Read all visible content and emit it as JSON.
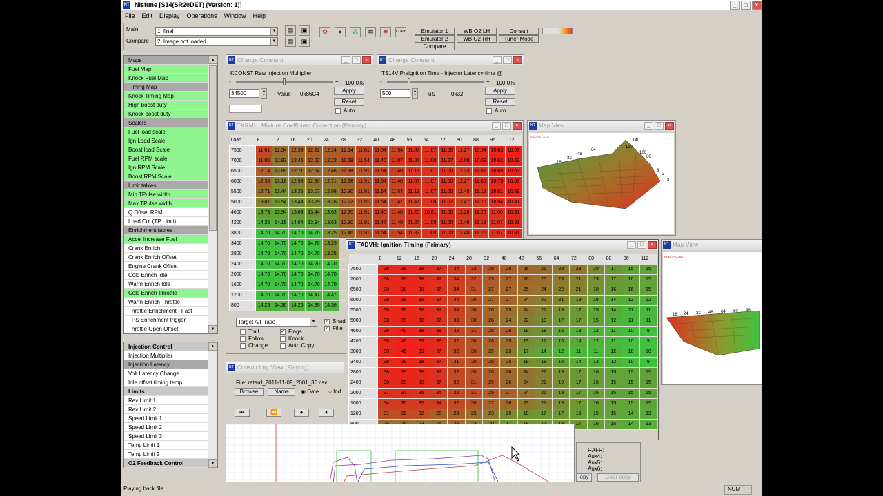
{
  "app": {
    "title": "Nistune [S14(SR20DET) (Version: 1)]",
    "status": "Playing back file",
    "status_num": "NUM"
  },
  "menu": [
    "File",
    "Edit",
    "Display",
    "Operations",
    "Window",
    "Help"
  ],
  "toolbar": {
    "main_label": "Main:",
    "main_value": "1: final",
    "compare_label": "Compare",
    "compare_value": "2: Image not loaded",
    "modes": [
      "Emulator 1",
      "WB O2 LH",
      "Consult",
      "Emulator 2",
      "WB O2 RH",
      "Tuner Mode",
      "Compare"
    ]
  },
  "nav": [
    {
      "t": "Maps",
      "s": "hdr"
    },
    {
      "t": "Fuel Map",
      "s": "green"
    },
    {
      "t": "Knock Fuel Map",
      "s": "green"
    },
    {
      "t": "Timing Map",
      "s": "hdr"
    },
    {
      "t": "Knock Timing Map",
      "s": "green"
    },
    {
      "t": "High boost duty",
      "s": "green"
    },
    {
      "t": "Knock boost duty",
      "s": "green"
    },
    {
      "t": "Scalers",
      "s": "hdr"
    },
    {
      "t": "Fuel load scale",
      "s": "green"
    },
    {
      "t": "Ign Load Scale",
      "s": "green"
    },
    {
      "t": "Boost load Scale",
      "s": "green"
    },
    {
      "t": "Fuel RPM scale",
      "s": "green"
    },
    {
      "t": "Ign RPM Scale",
      "s": "green"
    },
    {
      "t": "Boost RPM Scale",
      "s": "green"
    },
    {
      "t": "Limit tables",
      "s": "hdr"
    },
    {
      "t": "Min TPulse width",
      "s": "green"
    },
    {
      "t": "Max TPulse width",
      "s": "green"
    },
    {
      "t": "Q Offset RPM",
      "s": ""
    },
    {
      "t": "Load Cut (TP Limit)",
      "s": ""
    },
    {
      "t": "Enrichment tables",
      "s": "hdr"
    },
    {
      "t": "Accel Increase Fuel",
      "s": "green"
    },
    {
      "t": "Crank Enrich",
      "s": ""
    },
    {
      "t": "Crank Enrich Offset",
      "s": ""
    },
    {
      "t": "Engine Crank Offset",
      "s": ""
    },
    {
      "t": "Cold Enrich Idle",
      "s": ""
    },
    {
      "t": "Warm Enrich Idle",
      "s": ""
    },
    {
      "t": "Cold Enrich Throttle",
      "s": "green"
    },
    {
      "t": "Warm Enrich Throttle",
      "s": ""
    },
    {
      "t": "Throttle Enrichment - Fast",
      "s": ""
    },
    {
      "t": "TPS Enrichment trigger",
      "s": ""
    },
    {
      "t": "Throttle Open Offset",
      "s": ""
    }
  ],
  "nav2": [
    {
      "t": "Injection Control",
      "s": "hdr bold"
    },
    {
      "t": "Injection Multiplier",
      "s": ""
    },
    {
      "t": "Injection Latency",
      "s": "hdr"
    },
    {
      "t": "Volt Latency Change",
      "s": ""
    },
    {
      "t": "Idle offset timing temp",
      "s": ""
    },
    {
      "t": "Limits",
      "s": "hdr bold"
    },
    {
      "t": "Rev Limit 1",
      "s": ""
    },
    {
      "t": "Rev Limit 2",
      "s": ""
    },
    {
      "t": "Speed Limit 1",
      "s": ""
    },
    {
      "t": "Speed Limit 2",
      "s": ""
    },
    {
      "t": "Speed Limit 3",
      "s": ""
    },
    {
      "t": "Temp Limit 1",
      "s": ""
    },
    {
      "t": "Temp Limit 2",
      "s": ""
    },
    {
      "t": "O2 Feedback Control",
      "s": "hdr bold"
    }
  ],
  "cc1": {
    "title": "Change Constant",
    "label": "KCONST Raw Injection Mulitplier",
    "minus": "-",
    "plus": "+",
    "pct": "100.0%",
    "value": "34500",
    "value_label": "Value",
    "hex": "0x86C4",
    "apply": "Apply",
    "reset": "Reset",
    "auto": "Auto"
  },
  "cc2": {
    "title": "Change Constant",
    "label": "TS14V Preignition Time - Injector Latency time @",
    "minus": "-",
    "plus": "+",
    "pct": "100.0%",
    "value": "500",
    "unit": "uS",
    "hex": "0x32",
    "apply": "Apply",
    "reset": "Reset",
    "auto": "Auto"
  },
  "fuel": {
    "title": "TKRMH: Mixture Coefficient Correction (Primary)",
    "corner": "Load",
    "cols": [
      "8",
      "12",
      "16",
      "20",
      "24",
      "28",
      "32",
      "40",
      "48",
      "56",
      "64",
      "72",
      "80",
      "88",
      "96",
      "112"
    ],
    "rows": [
      "7500",
      "7000",
      "6500",
      "6000",
      "5500",
      "5000",
      "4600",
      "4200",
      "3800",
      "3400",
      "2800",
      "2400",
      "2000",
      "1600",
      "1200",
      "800"
    ],
    "data": [
      [
        "11.61",
        "12.54",
        "12.38",
        "12.22",
        "12.14",
        "12.14",
        "11.61",
        "11.54",
        "11.54",
        "11.07",
        "11.07",
        "11.00",
        "11.27",
        "10.94",
        "10.63",
        "10.63"
      ],
      [
        "11.80",
        "12.83",
        "12.46",
        "12.22",
        "12.22",
        "11.69",
        "11.54",
        "11.40",
        "11.07",
        "11.07",
        "11.00",
        "11.27",
        "11.00",
        "10.69",
        "10.63",
        "10.63"
      ],
      [
        "12.14",
        "12.89",
        "12.71",
        "12.54",
        "12.46",
        "11.98",
        "11.91",
        "11.54",
        "11.40",
        "11.13",
        "11.07",
        "11.00",
        "11.33",
        "11.07",
        "10.69",
        "10.63"
      ],
      [
        "12.38",
        "13.18",
        "12.98",
        "12.80",
        "12.71",
        "12.38",
        "11.91",
        "11.54",
        "11.40",
        "11.07",
        "11.07",
        "11.00",
        "11.27",
        "11.00",
        "10.75",
        "10.63"
      ],
      [
        "12.71",
        "13.44",
        "13.25",
        "13.07",
        "12.98",
        "12.30",
        "11.91",
        "11.54",
        "11.54",
        "11.13",
        "11.07",
        "11.00",
        "11.40",
        "11.13",
        "10.81",
        "10.69"
      ],
      [
        "13.07",
        "13.54",
        "13.44",
        "13.29",
        "13.16",
        "12.22",
        "11.91",
        "11.54",
        "11.47",
        "11.47",
        "11.00",
        "11.07",
        "11.47",
        "11.20",
        "10.94",
        "10.81"
      ],
      [
        "13.73",
        "13.94",
        "13.63",
        "13.44",
        "13.63",
        "12.30",
        "11.91",
        "11.40",
        "11.40",
        "11.20",
        "10.81",
        "11.00",
        "11.20",
        "11.20",
        "11.00",
        "10.81"
      ],
      [
        "14.25",
        "14.15",
        "14.04",
        "13.94",
        "13.63",
        "12.30",
        "11.91",
        "11.47",
        "11.40",
        "11.27",
        "11.00",
        "11.00",
        "11.40",
        "11.13",
        "11.07",
        "10.81"
      ],
      [
        "14.70",
        "14.70",
        "14.70",
        "14.70",
        "13.25",
        "12.46",
        "11.91",
        "11.54",
        "11.54",
        "11.33",
        "11.00",
        "11.00",
        "11.40",
        "11.20",
        "11.07",
        "10.81"
      ],
      [
        "14.70",
        "14.70",
        "14.70",
        "14.70",
        "13.25",
        "",
        "",
        "",
        "",
        "",
        "",
        "",
        "",
        "",
        "",
        ""
      ],
      [
        "14.70",
        "14.70",
        "14.70",
        "14.70",
        "13.25",
        "",
        "",
        "",
        "",
        "",
        "",
        "",
        "",
        "",
        "",
        ""
      ],
      [
        "14.70",
        "14.70",
        "14.70",
        "14.70",
        "14.70",
        "",
        "",
        "",
        "",
        "",
        "",
        "",
        "",
        "",
        "",
        ""
      ],
      [
        "14.70",
        "14.70",
        "14.70",
        "14.70",
        "14.70",
        "",
        "",
        "",
        "",
        "",
        "",
        "",
        "",
        "",
        "",
        ""
      ],
      [
        "14.70",
        "14.70",
        "14.70",
        "14.70",
        "14.70",
        "",
        "",
        "",
        "",
        "",
        "",
        "",
        "",
        "",
        "",
        ""
      ],
      [
        "14.70",
        "14.70",
        "14.70",
        "14.47",
        "14.47",
        "",
        "",
        "",
        "",
        "",
        "",
        "",
        "",
        "",
        "",
        ""
      ],
      [
        "14.25",
        "14.36",
        "14.26",
        "14.36",
        "14.36",
        "",
        "",
        "",
        "",
        "",
        "",
        "",
        "",
        "",
        "",
        ""
      ]
    ]
  },
  "fuel_opts": {
    "target": "Target A/F ratio",
    "trail": "Trail",
    "follow": "Follow",
    "change": "Change",
    "flags": "Flags",
    "knock": "Knock",
    "autocopy": "Auto Copy",
    "shade": "Shad",
    "filled": "Fille"
  },
  "timing": {
    "title": "TADVH: Ignition Timing (Primary)",
    "corner": "",
    "cols": [
      "8",
      "12",
      "16",
      "20",
      "24",
      "28",
      "32",
      "40",
      "48",
      "56",
      "64",
      "72",
      "80",
      "88",
      "96",
      "112"
    ],
    "rows": [
      "7500",
      "7000",
      "6500",
      "6000",
      "5500",
      "5000",
      "4600",
      "4200",
      "3800",
      "3400",
      "2800",
      "2400",
      "2000",
      "1600",
      "1200",
      "800"
    ],
    "data": [
      [
        "38",
        "39",
        "38",
        "37",
        "34",
        "32",
        "29",
        "28",
        "26",
        "25",
        "23",
        "23",
        "20",
        "17",
        "15",
        "15"
      ],
      [
        "38",
        "39",
        "38",
        "37",
        "34",
        "32",
        "29",
        "27",
        "26",
        "25",
        "23",
        "21",
        "19",
        "17",
        "16",
        "15"
      ],
      [
        "38",
        "39",
        "38",
        "37",
        "34",
        "31",
        "27",
        "27",
        "25",
        "24",
        "22",
        "21",
        "18",
        "16",
        "16",
        "15"
      ],
      [
        "38",
        "39",
        "38",
        "37",
        "34",
        "30",
        "27",
        "27",
        "24",
        "22",
        "21",
        "19",
        "16",
        "14",
        "13",
        "12"
      ],
      [
        "38",
        "39",
        "38",
        "37",
        "34",
        "30",
        "26",
        "25",
        "24",
        "21",
        "19",
        "17",
        "15",
        "14",
        "11",
        "11"
      ],
      [
        "38",
        "39",
        "38",
        "37",
        "33",
        "30",
        "26",
        "24",
        "22",
        "19",
        "17",
        "17",
        "15",
        "12",
        "11",
        "11"
      ],
      [
        "38",
        "40",
        "39",
        "38",
        "32",
        "31",
        "28",
        "28",
        "19",
        "18",
        "15",
        "13",
        "12",
        "11",
        "10",
        "9"
      ],
      [
        "38",
        "40",
        "39",
        "38",
        "32",
        "30",
        "28",
        "25",
        "19",
        "17",
        "15",
        "14",
        "12",
        "11",
        "10",
        "9"
      ],
      [
        "38",
        "40",
        "39",
        "37",
        "32",
        "30",
        "25",
        "23",
        "17",
        "14",
        "12",
        "11",
        "11",
        "12",
        "10",
        "10"
      ],
      [
        "38",
        "39",
        "38",
        "37",
        "31",
        "30",
        "28",
        "25",
        "19",
        "18",
        "16",
        "14",
        "13",
        "12",
        "10",
        "9"
      ],
      [
        "38",
        "39",
        "38",
        "37",
        "32",
        "30",
        "28",
        "26",
        "24",
        "22",
        "19",
        "17",
        "16",
        "15",
        "15",
        "15"
      ],
      [
        "38",
        "39",
        "38",
        "37",
        "32",
        "31",
        "29",
        "26",
        "24",
        "21",
        "19",
        "17",
        "16",
        "15",
        "15",
        "15"
      ],
      [
        "37",
        "37",
        "36",
        "34",
        "32",
        "31",
        "29",
        "27",
        "24",
        "21",
        "19",
        "17",
        "16",
        "15",
        "15",
        "15"
      ],
      [
        "34",
        "35",
        "35",
        "34",
        "32",
        "30",
        "27",
        "26",
        "23",
        "21",
        "19",
        "17",
        "16",
        "15",
        "15",
        "15"
      ],
      [
        "31",
        "32",
        "32",
        "28",
        "28",
        "25",
        "23",
        "20",
        "18",
        "17",
        "17",
        "16",
        "15",
        "15",
        "14",
        "13"
      ],
      [
        "25",
        "25",
        "23",
        "25",
        "26",
        "23",
        "20",
        "17",
        "18",
        "17",
        "18",
        "17",
        "16",
        "15",
        "14",
        "13"
      ]
    ]
  },
  "mapview1": {
    "title": "Map View",
    "labels": [
      "140",
      "120",
      "100",
      "80",
      "64",
      "48",
      "32",
      "16",
      "8",
      "4",
      "2"
    ]
  },
  "mapview2": {
    "title": "Map View",
    "labels": [
      "16",
      "24",
      "32",
      "48",
      "64",
      "80",
      "96"
    ]
  },
  "consult": {
    "title": "Consult Log View (Playing)",
    "file": "File: retard_2011-11-09_2001_36.csv",
    "browse": "Browse",
    "name": "Name",
    "date": "Date",
    "ind": "Ind",
    "aux": [
      "RAFR:",
      "Aux4:",
      "Aux5:",
      "Aux6:"
    ],
    "copy": "opy",
    "gear_copy": "Gear copy"
  },
  "colors": {
    "red": "#f0201a",
    "green": "#3fc23f"
  }
}
